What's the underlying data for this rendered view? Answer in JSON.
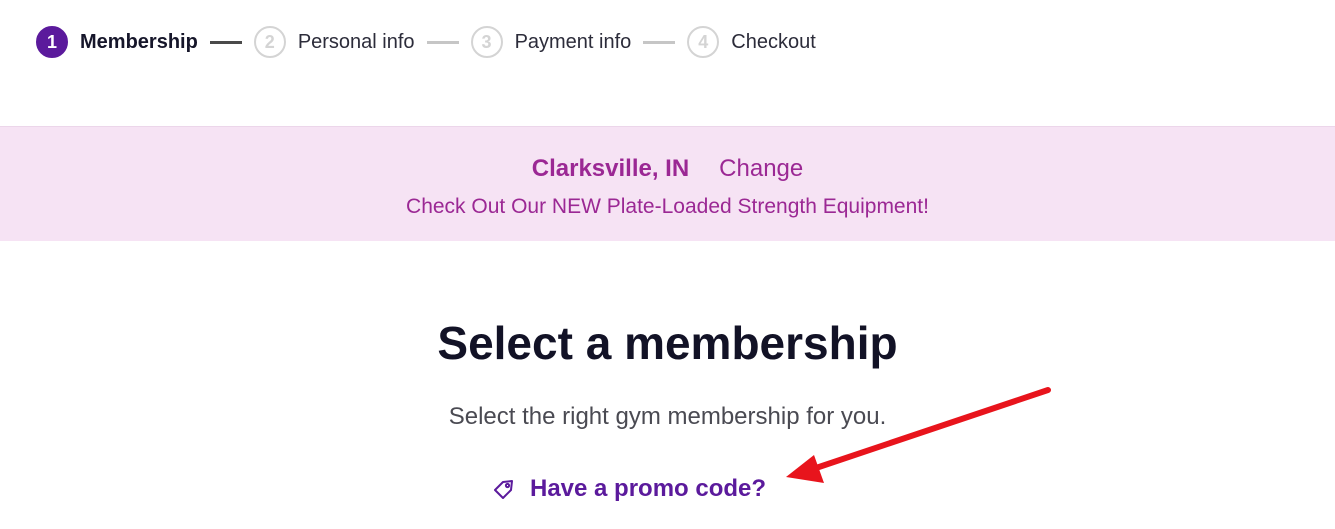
{
  "stepper": {
    "steps": [
      {
        "number": "1",
        "label": "Membership"
      },
      {
        "number": "2",
        "label": "Personal info"
      },
      {
        "number": "3",
        "label": "Payment info"
      },
      {
        "number": "4",
        "label": "Checkout"
      }
    ]
  },
  "banner": {
    "location": "Clarksville, IN",
    "change_label": "Change",
    "announcement": "Check Out Our NEW Plate-Loaded Strength Equipment!"
  },
  "main": {
    "title": "Select a membership",
    "subtitle": "Select the right gym membership for you.",
    "promo_link": "Have a promo code?",
    "promo_icon": "tag-icon"
  },
  "annotation": {
    "arrow_color": "#e8141c"
  },
  "colors": {
    "brand_purple": "#5b1a9c",
    "banner_bg": "#f6e3f4",
    "banner_text": "#9b2894"
  }
}
